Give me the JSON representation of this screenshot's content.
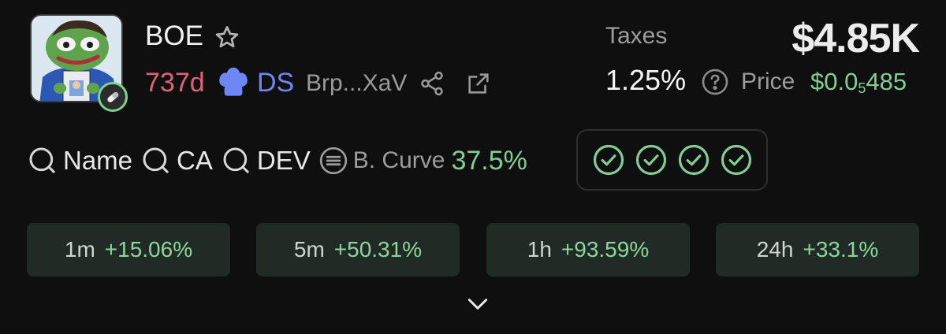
{
  "token": {
    "name": "BOE",
    "age": "737d",
    "dex_label": "DS",
    "address": "Brp...XaV"
  },
  "taxes": {
    "label": "Taxes",
    "value": "1.25%"
  },
  "price": {
    "label": "Price",
    "prefix": "$0.0",
    "zeros": "5",
    "suffix": "485"
  },
  "market_cap": "$4.85K",
  "filters": {
    "name_label": "Name",
    "ca_label": "CA",
    "dev_label": "DEV",
    "curve_label": "B. Curve",
    "curve_value": "37.5%"
  },
  "checks": {
    "count": 4,
    "color": "#82cf95"
  },
  "changes": [
    {
      "timeframe": "1m",
      "value": "+15.06%"
    },
    {
      "timeframe": "5m",
      "value": "+50.31%"
    },
    {
      "timeframe": "1h",
      "value": "+93.59%"
    },
    {
      "timeframe": "24h",
      "value": "+33.1%"
    }
  ],
  "colors": {
    "background": "#0f0f10",
    "age": "#e0627a",
    "dex": "#6f86f5",
    "positive": "#82cf95",
    "pill_bg": "#1f2b24"
  },
  "icons": [
    "star-icon",
    "chef-hat-icon",
    "share-icon",
    "external-link-icon",
    "help-icon",
    "search-icon",
    "curve-icon",
    "check-circle-icon",
    "chevron-down-icon",
    "pill-icon"
  ]
}
